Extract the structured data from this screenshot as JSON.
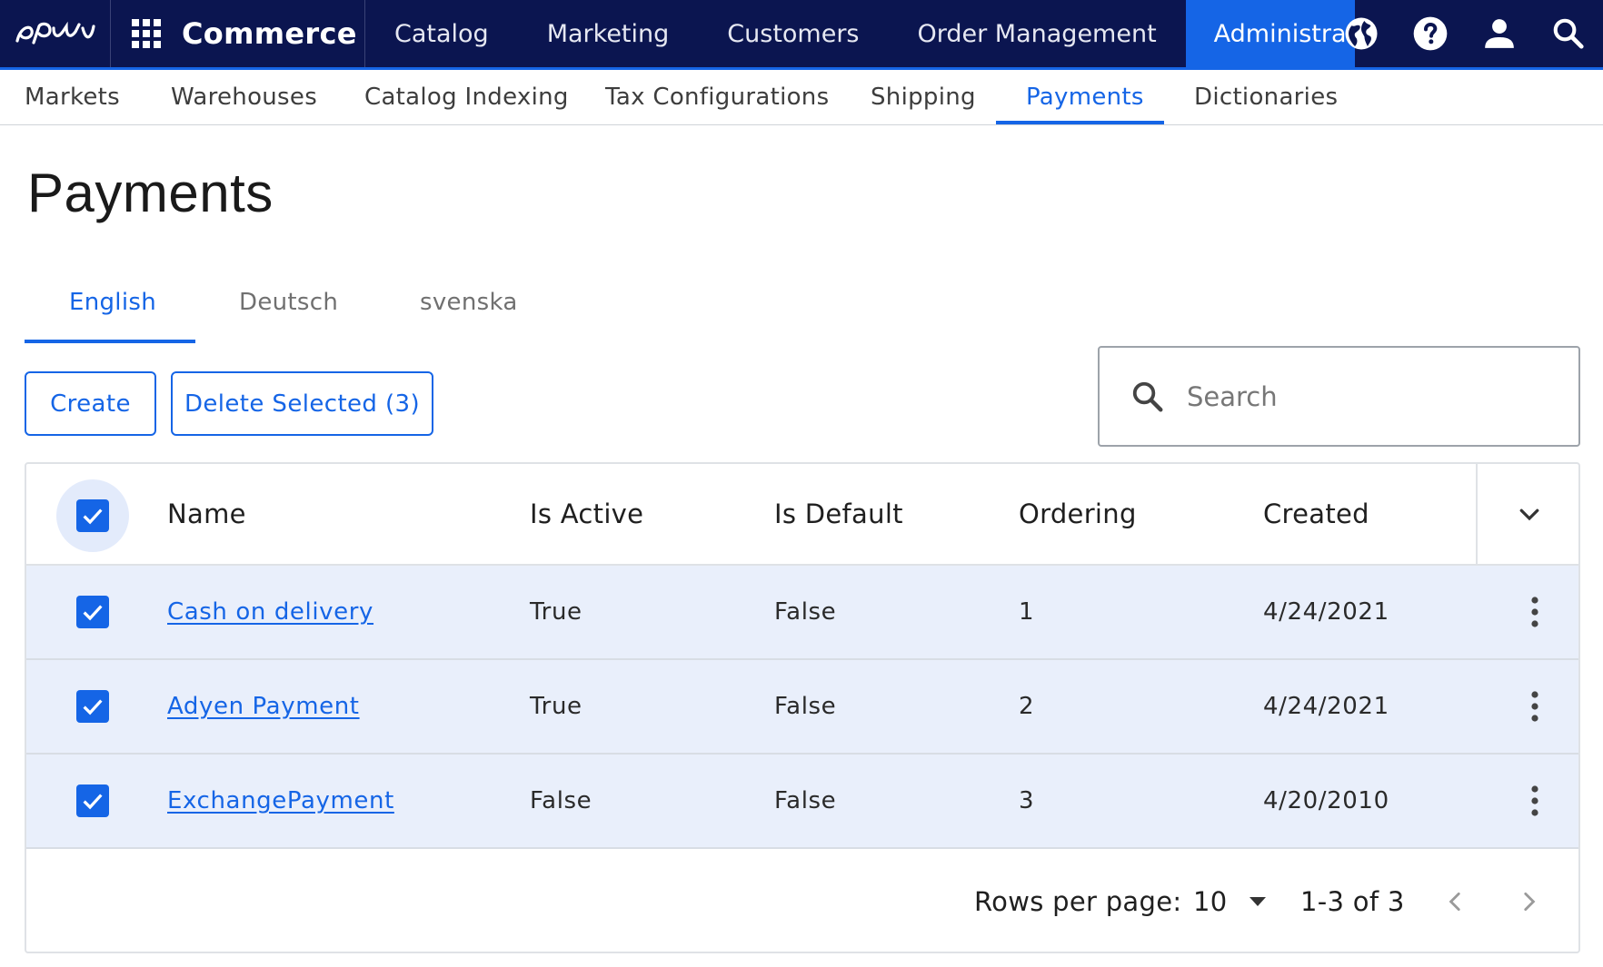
{
  "topnav": {
    "brand": "Commerce",
    "items": [
      {
        "label": "Catalog"
      },
      {
        "label": "Marketing"
      },
      {
        "label": "Customers"
      },
      {
        "label": "Order Management"
      },
      {
        "label": "Administration",
        "active": true
      }
    ],
    "icons": [
      "globe-icon",
      "help-icon",
      "user-icon",
      "search-icon"
    ]
  },
  "subnav": {
    "items": [
      {
        "label": "Markets"
      },
      {
        "label": "Warehouses"
      },
      {
        "label": "Catalog Indexing"
      },
      {
        "label": "Tax Configurations"
      },
      {
        "label": "Shipping"
      },
      {
        "label": "Payments",
        "active": true
      },
      {
        "label": "Dictionaries"
      }
    ]
  },
  "page": {
    "title": "Payments"
  },
  "languages": [
    {
      "label": "English",
      "active": true
    },
    {
      "label": "Deutsch"
    },
    {
      "label": "svenska"
    }
  ],
  "toolbar": {
    "create_label": "Create",
    "delete_label": "Delete Selected (3)"
  },
  "search": {
    "placeholder": "Search",
    "value": ""
  },
  "table": {
    "columns": [
      "Name",
      "Is Active",
      "Is Default",
      "Ordering",
      "Created"
    ],
    "all_selected": true,
    "rows": [
      {
        "name": "Cash on delivery",
        "is_active": "True",
        "is_default": "False",
        "ordering": "1",
        "created": "4/24/2021",
        "selected": true
      },
      {
        "name": "Adyen Payment",
        "is_active": "True",
        "is_default": "False",
        "ordering": "2",
        "created": "4/24/2021",
        "selected": true
      },
      {
        "name": "ExchangePayment",
        "is_active": "False",
        "is_default": "False",
        "ordering": "3",
        "created": "4/20/2010",
        "selected": true
      }
    ]
  },
  "pagination": {
    "rows_per_page_label": "Rows per page:",
    "rows_per_page_value": "10",
    "range_text": "1-3 of 3"
  },
  "colors": {
    "nav_background": "#0b1550",
    "accent": "#1565e6",
    "row_selected": "#e9effb"
  }
}
